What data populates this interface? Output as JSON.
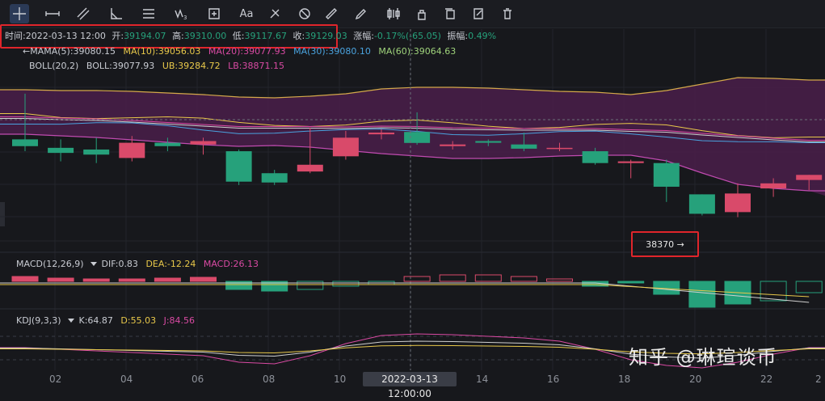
{
  "toolbar": {
    "tools": [
      "crosshair-icon",
      "horizontal-line-icon",
      "parallel-channel-icon",
      "angle-icon",
      "fib-lines-icon",
      "wave-icon",
      "measure-box-icon",
      "text-icon",
      "brush-icon",
      "fill-icon",
      "ruler-icon",
      "pen-icon",
      "candle-style-icon",
      "lock-icon",
      "copy-icon",
      "edit-icon",
      "trash-icon"
    ],
    "text_tool_label": "Aa",
    "wave_tool_label": "W3"
  },
  "header": {
    "time_label": "时间:",
    "time": "2022-03-13 12:00",
    "open_label": "开:",
    "open": "39194.07",
    "high_label": "高:",
    "high": "39310.00",
    "low_label": "低:",
    "low": "39117.67",
    "close_label": "收:",
    "close": "39129.03",
    "change_label": "涨幅:",
    "change": "-0.17%(-65.05)",
    "amp_label": "振幅:",
    "amp": "0.49%"
  },
  "ma": {
    "prefix": "←MA",
    "name": "MA(5):39080.15",
    "ma10": "MA(10):39056.03",
    "ma20": "MA(20):39077.93",
    "ma30": "MA(30):39080.10",
    "ma60": "MA(60):39064.63"
  },
  "boll": {
    "name": "BOLL(20,2)",
    "mid": "BOLL:39077.93",
    "ub": "UB:39284.72",
    "lb": "LB:38871.15"
  },
  "macd": {
    "name": "MACD(12,26,9)",
    "dif": "DIF:0.83",
    "dea": "DEA:-12.24",
    "macd": "MACD:26.13"
  },
  "kdj": {
    "name": "KDJ(9,3,3)",
    "k": "K:64.87",
    "d": "D:55.03",
    "j": "J:84.56"
  },
  "price_tag": "38370 →",
  "watermark": "知乎 @琳瑄谈币",
  "cursor_date": "2022-03-13 12:00:00",
  "x_ticks": [
    "02",
    "04",
    "06",
    "08",
    "10",
    "14",
    "16",
    "18",
    "20",
    "22",
    "2"
  ],
  "colors": {
    "up": "#d94a6a",
    "down": "#26a17b",
    "boll_band": "#4a1f4a",
    "highlight": "#e0252b"
  },
  "chart_data": {
    "type": "candlestick",
    "note_series": "OHLC candles, half-day bars",
    "candles": [
      {
        "o": 39150,
        "h": 39420,
        "l": 39080,
        "c": 39110
      },
      {
        "o": 39100,
        "h": 39150,
        "l": 39020,
        "c": 39070
      },
      {
        "o": 39090,
        "h": 39160,
        "l": 39010,
        "c": 39060
      },
      {
        "o": 39040,
        "h": 39170,
        "l": 39020,
        "c": 39130
      },
      {
        "o": 39130,
        "h": 39160,
        "l": 39080,
        "c": 39110
      },
      {
        "o": 39120,
        "h": 39160,
        "l": 39060,
        "c": 39140
      },
      {
        "o": 39080,
        "h": 39090,
        "l": 38880,
        "c": 38900
      },
      {
        "o": 38950,
        "h": 38970,
        "l": 38880,
        "c": 38895
      },
      {
        "o": 38960,
        "h": 39220,
        "l": 38950,
        "c": 39000
      },
      {
        "o": 39050,
        "h": 39200,
        "l": 39030,
        "c": 39160
      },
      {
        "o": 39180,
        "h": 39210,
        "l": 39150,
        "c": 39190
      },
      {
        "o": 39194,
        "h": 39310,
        "l": 39118,
        "c": 39129
      },
      {
        "o": 39110,
        "h": 39140,
        "l": 39090,
        "c": 39120
      },
      {
        "o": 39140,
        "h": 39150,
        "l": 39110,
        "c": 39130
      },
      {
        "o": 39120,
        "h": 39190,
        "l": 39080,
        "c": 39095
      },
      {
        "o": 39100,
        "h": 39130,
        "l": 39080,
        "c": 39100
      },
      {
        "o": 39080,
        "h": 39100,
        "l": 39000,
        "c": 39010
      },
      {
        "o": 39010,
        "h": 39030,
        "l": 38920,
        "c": 39020
      },
      {
        "o": 39010,
        "h": 39030,
        "l": 38780,
        "c": 38870
      },
      {
        "o": 38825,
        "h": 38825,
        "l": 38700,
        "c": 38710
      },
      {
        "o": 38720,
        "h": 38890,
        "l": 38690,
        "c": 38830
      },
      {
        "o": 38860,
        "h": 38920,
        "l": 38810,
        "c": 38890
      },
      {
        "o": 38910,
        "h": 38940,
        "l": 38850,
        "c": 38940
      }
    ],
    "ylim": [
      38540,
      39520
    ]
  }
}
